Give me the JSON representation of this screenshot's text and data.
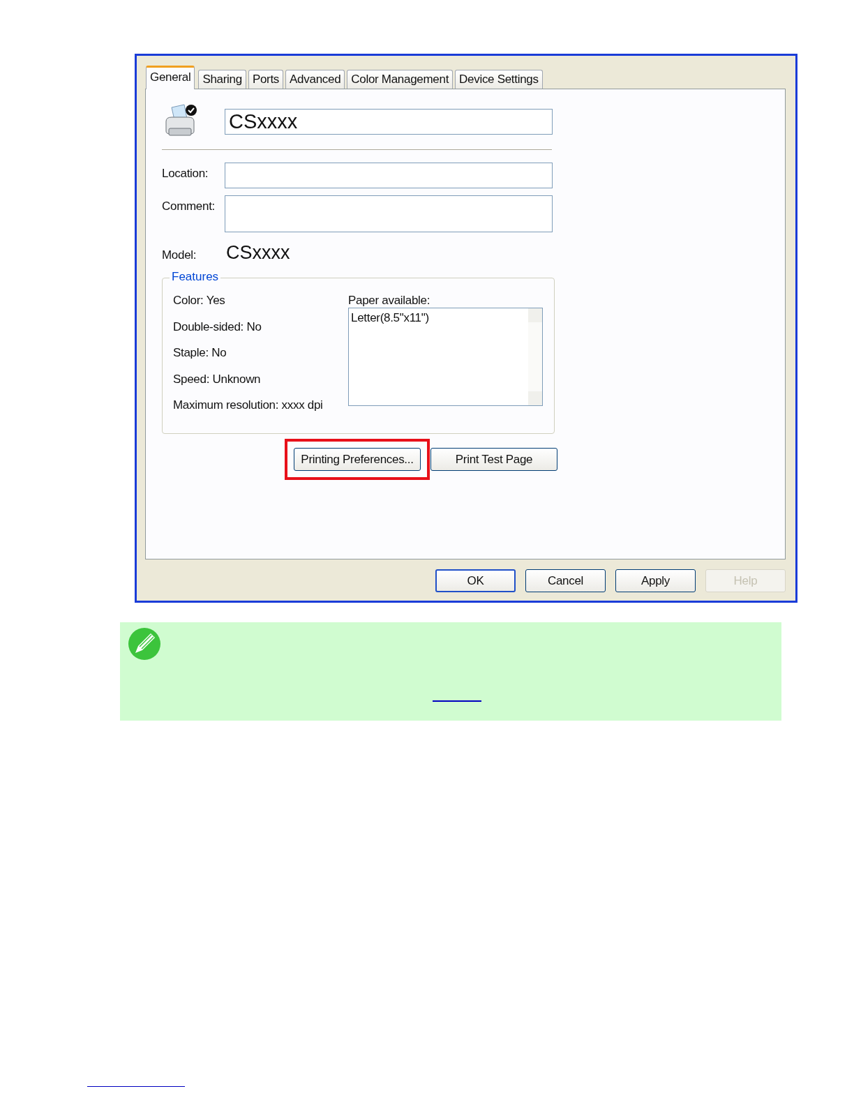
{
  "dialog": {
    "tabs": [
      {
        "label": "General",
        "selected": true
      },
      {
        "label": "Sharing",
        "selected": false
      },
      {
        "label": "Ports",
        "selected": false
      },
      {
        "label": "Advanced",
        "selected": false
      },
      {
        "label": "Color Management",
        "selected": false
      },
      {
        "label": "Device Settings",
        "selected": false
      }
    ],
    "printer_name": "CSxxxx",
    "fields": [
      {
        "label": "Location:",
        "kind": "line"
      },
      {
        "label": "Comment:",
        "kind": "box"
      }
    ],
    "model": {
      "label": "Model:",
      "value": "CSxxxx"
    },
    "features": {
      "title": "Features",
      "items": [
        "Color: Yes",
        "Double-sided: No",
        "Staple: No",
        "Speed: Unknown",
        "Maximum resolution: xxxx dpi"
      ],
      "paper_label": "Paper available:",
      "paper_list": [
        "Letter(8.5\"x11\")"
      ]
    },
    "panel_buttons": [
      {
        "label": "Printing Preferences...",
        "highlighted": true
      },
      {
        "label": "Print Test Page",
        "highlighted": false
      }
    ],
    "buttons": [
      {
        "label": "OK",
        "default": true,
        "disabled": false
      },
      {
        "label": "Cancel",
        "default": false,
        "disabled": false
      },
      {
        "label": "Apply",
        "default": false,
        "disabled": false
      },
      {
        "label": "Help",
        "default": false,
        "disabled": true
      }
    ]
  }
}
